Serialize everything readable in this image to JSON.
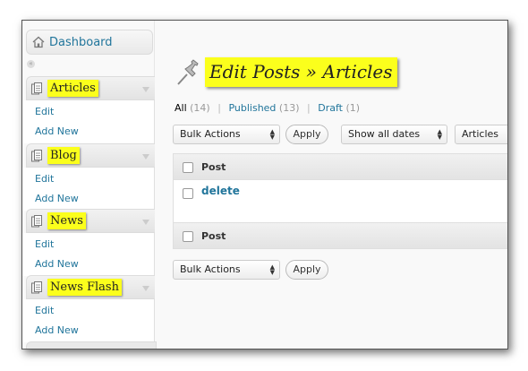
{
  "sidebar": {
    "dashboard": "Dashboard",
    "menus": [
      {
        "label": "Articles",
        "items": [
          "Edit",
          "Add New"
        ]
      },
      {
        "label": "Blog",
        "items": [
          "Edit",
          "Add New"
        ]
      },
      {
        "label": "News",
        "items": [
          "Edit",
          "Add New"
        ]
      },
      {
        "label": "News Flash",
        "items": [
          "Edit",
          "Add New"
        ]
      }
    ]
  },
  "main": {
    "title": "Edit Posts » Articles",
    "filters": {
      "all": "All",
      "all_count": "(14)",
      "published": "Published",
      "published_count": "(13)",
      "draft": "Draft",
      "draft_count": "(1)",
      "sep": "|"
    },
    "bulk_actions": "Bulk Actions",
    "apply": "Apply",
    "date_filter": "Show all dates",
    "category_filter": "Articles",
    "column_post": "Post",
    "rows": [
      {
        "title": "delete"
      }
    ]
  },
  "colors": {
    "highlight": "#fbff1c",
    "link": "#21759b"
  },
  "icons": [
    "home-icon",
    "pushpin-icon",
    "document-icon",
    "dropdown-arrow-icon"
  ]
}
